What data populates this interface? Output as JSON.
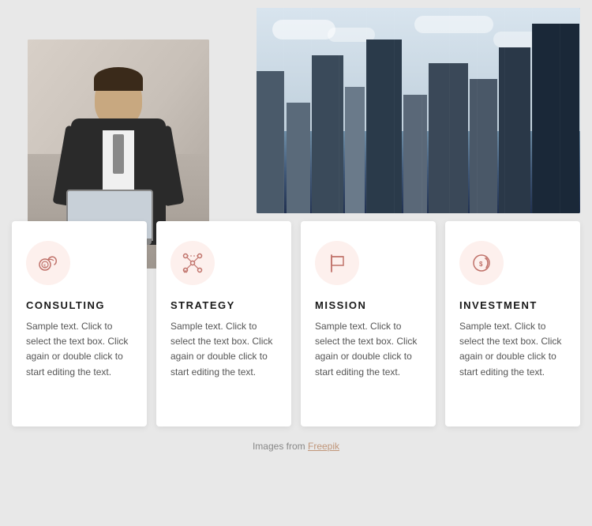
{
  "images": {
    "city_alt": "City buildings",
    "person_alt": "Business person with laptop"
  },
  "cards": [
    {
      "id": "consulting",
      "icon": "coins-icon",
      "title": "CONSULTING",
      "text": "Sample text. Click to select the text box. Click again or double click to start editing the text."
    },
    {
      "id": "strategy",
      "icon": "strategy-icon",
      "title": "STRATEGY",
      "text": "Sample text. Click to select the text box. Click again or double click to start editing the text."
    },
    {
      "id": "mission",
      "icon": "flag-icon",
      "title": "MISSION",
      "text": "Sample text. Click to select the text box. Click again or double click to start editing the text."
    },
    {
      "id": "investment",
      "icon": "investment-icon",
      "title": "INVESTMENT",
      "text": "Sample text. Click to select the text box. Click again or double click to start editing the text."
    }
  ],
  "footer": {
    "credit_text": "Images from ",
    "credit_link": "Freepik"
  }
}
